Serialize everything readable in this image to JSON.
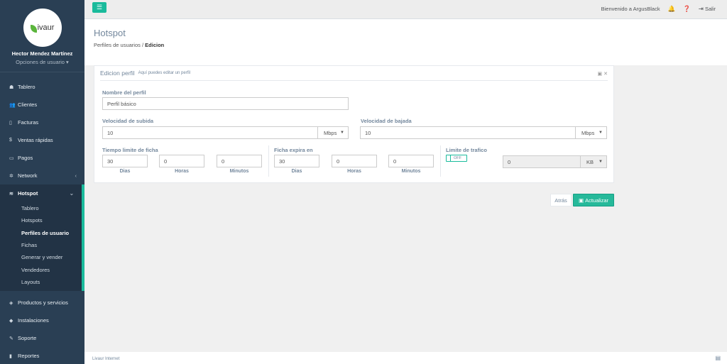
{
  "brand": {
    "logo_text": "ivaur"
  },
  "profile": {
    "name": "Hector Mendez Martínez",
    "options": "Opciones de usuario ▾"
  },
  "nav": {
    "tablero": "Tablero",
    "clientes": "Clientes",
    "facturas": "Facturas",
    "ventas": "Ventas rápidas",
    "pagos": "Pagos",
    "network": "Network",
    "hotspot": "Hotspot",
    "hotspot_items": [
      "Tablero",
      "Hotspots",
      "Perfiles de usuario",
      "Fichas",
      "Generar y vender",
      "Vendedores",
      "Layouts"
    ],
    "productos": "Productos y servicios",
    "instalaciones": "Instalaciones",
    "soporte": "Soporte",
    "reportes": "Reportes"
  },
  "topbar": {
    "welcome": "Bienvenido a ArgusBlack",
    "logout": "Salir"
  },
  "page": {
    "title": "Hotspot",
    "breadcrumb_parent": "Perfiles de usuarios",
    "breadcrumb_sep": "/",
    "breadcrumb_current": "Edicion"
  },
  "panel": {
    "title": "Edicion perfil",
    "subtitle": "Aquí puedes editar un perfil"
  },
  "form": {
    "profile_name_label": "Nombre del perfil",
    "profile_name": "Perfil básico",
    "upload_label": "Velocidad de subida",
    "upload_value": "10",
    "upload_unit": "Mbps",
    "download_label": "Velocidad de bajada",
    "download_value": "10",
    "download_unit": "Mbps",
    "time_limit_label": "Tiempo limite de ficha",
    "time_days": "30",
    "time_hours": "0",
    "time_minutes": "0",
    "expire_label": "Ficha expira en",
    "exp_days": "30",
    "exp_hours": "0",
    "exp_minutes": "0",
    "days_label": "Dias",
    "hours_label": "Horas",
    "minutes_label": "Minutos",
    "traffic_label": "Limite de trafico",
    "toggle_text": "OFF",
    "traffic_value": "0",
    "traffic_unit": "KB"
  },
  "buttons": {
    "back": "Atrás",
    "update": "Actualizar"
  },
  "footer": {
    "text": "Livaur Internet"
  },
  "colors": {
    "sidebar": "#2a3f54",
    "accent": "#1abb9c",
    "button": "#26b99a"
  }
}
